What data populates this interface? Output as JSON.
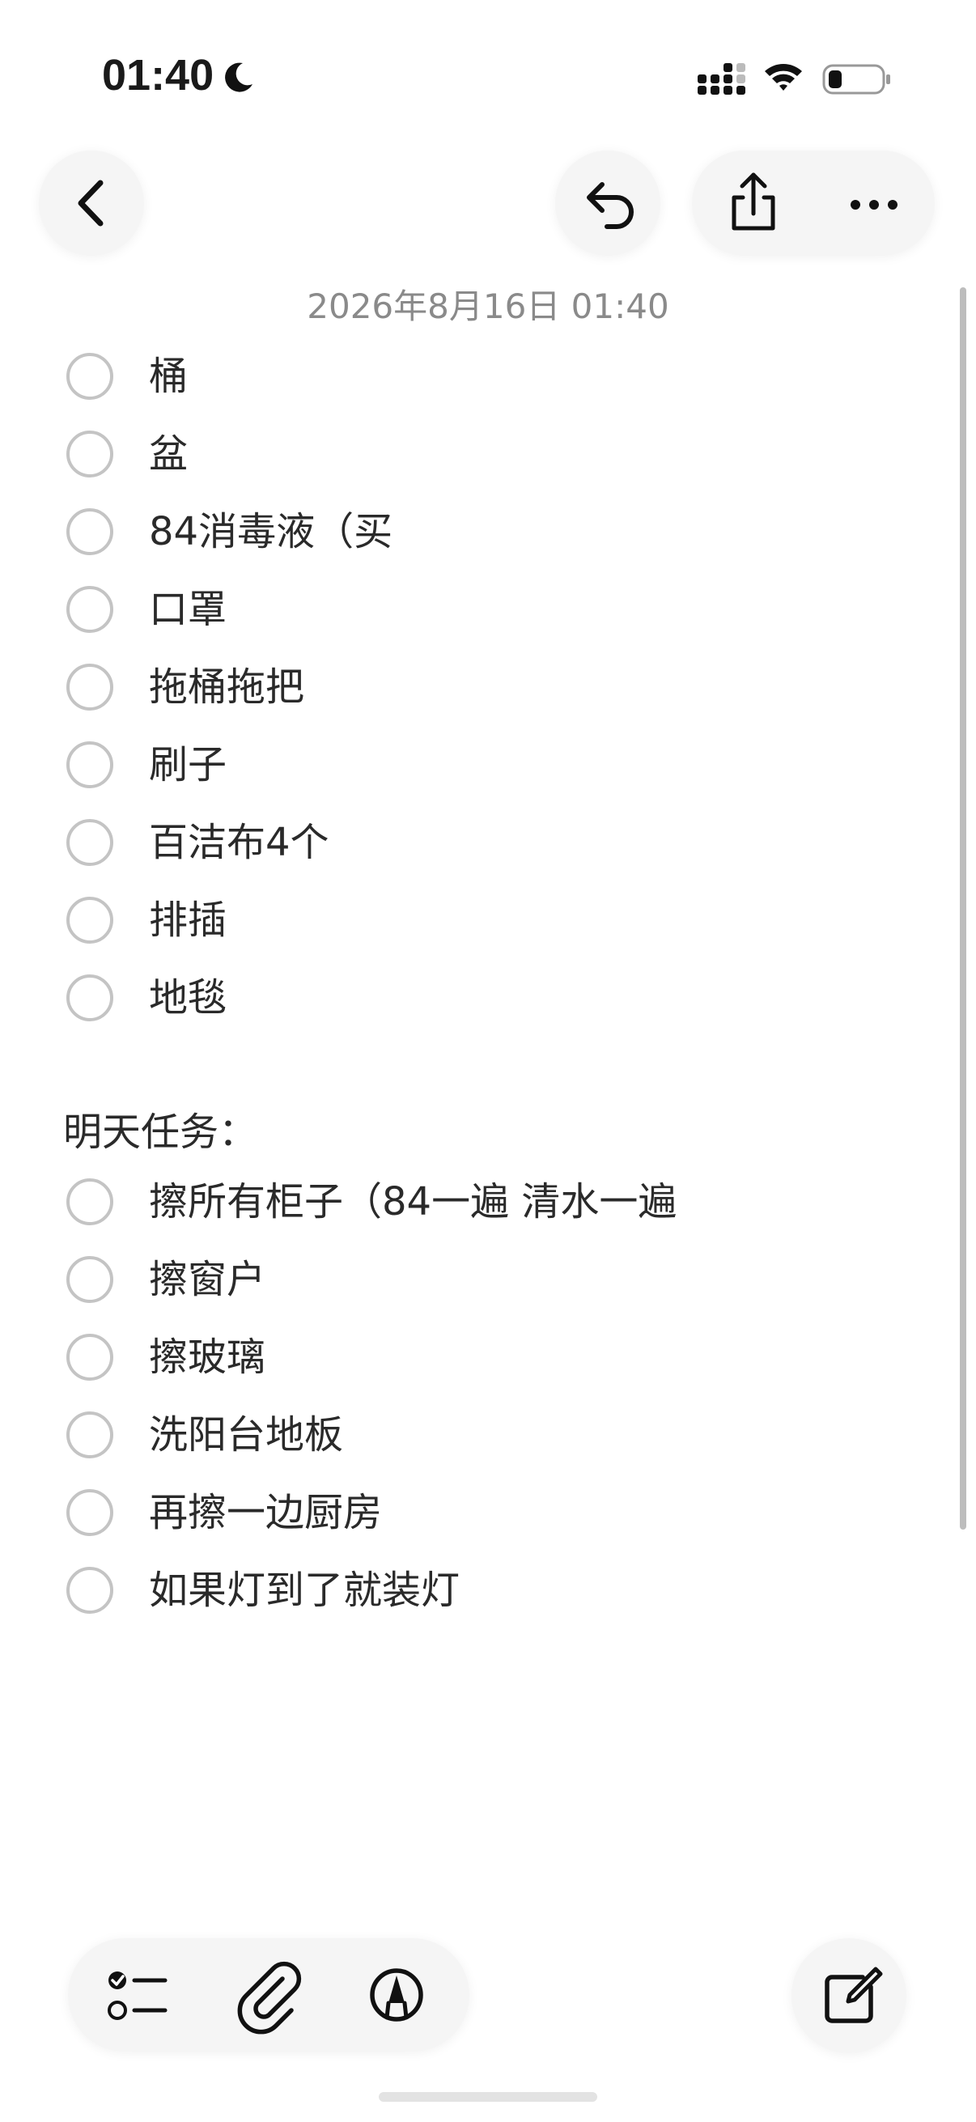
{
  "status_bar": {
    "time": "01:40",
    "icons": [
      "moon-icon",
      "cellular-signal-icon",
      "wifi-icon",
      "battery-icon"
    ]
  },
  "nav": {
    "back_icon": "chevron-left-icon",
    "undo_icon": "undo-icon",
    "share_icon": "share-icon",
    "more_icon": "ellipsis-icon"
  },
  "note": {
    "date": "2026年8月16日 01:40",
    "checklist": [
      {
        "text": "桶",
        "checked": false
      },
      {
        "text": "盆",
        "checked": false
      },
      {
        "text": "84消毒液（买",
        "checked": false
      },
      {
        "text": "口罩",
        "checked": false
      },
      {
        "text": "拖桶拖把",
        "checked": false
      },
      {
        "text": "刷子",
        "checked": false
      },
      {
        "text": "百洁布4个",
        "checked": false
      },
      {
        "text": "排插",
        "checked": false
      },
      {
        "text": "地毯",
        "checked": false
      }
    ],
    "section_heading": "明天任务：",
    "tasks": [
      {
        "text": "擦所有柜子（84一遍 清水一遍",
        "checked": false
      },
      {
        "text": "擦窗户",
        "checked": false
      },
      {
        "text": "擦玻璃",
        "checked": false
      },
      {
        "text": "洗阳台地板",
        "checked": false
      },
      {
        "text": "再擦一边厨房",
        "checked": false
      },
      {
        "text": "如果灯到了就装灯",
        "checked": false
      }
    ]
  },
  "toolbar": {
    "checklist_icon": "checklist-icon",
    "attachment_icon": "paperclip-icon",
    "markup_icon": "pen-markup-icon",
    "compose_icon": "compose-icon"
  },
  "colors": {
    "background": "#ffffff",
    "button_bg": "#f5f5f5",
    "circle_border": "#c4c4c4",
    "text": "#2a2a2a",
    "date_text": "#8a8a8a"
  }
}
